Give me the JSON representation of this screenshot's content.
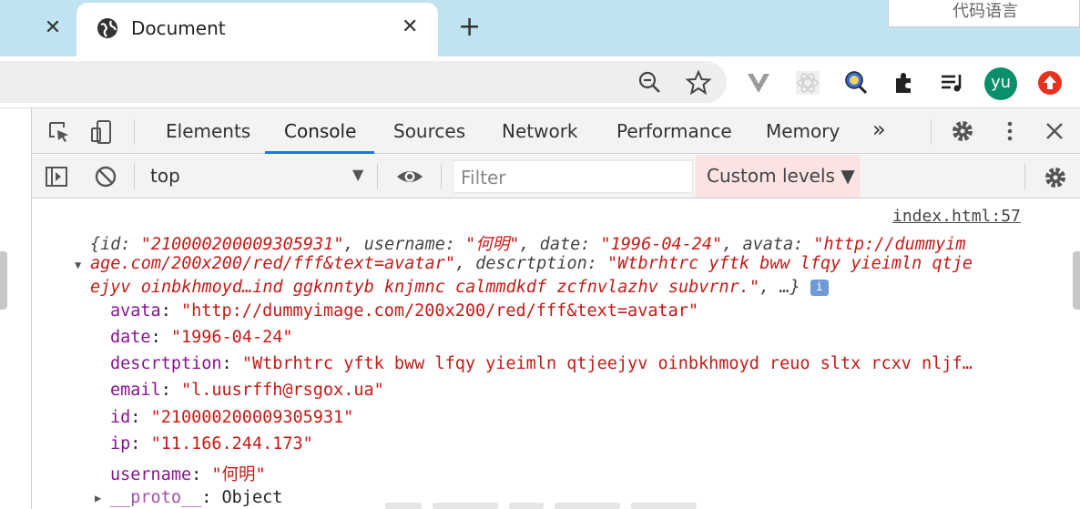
{
  "browser": {
    "tab_title": "Document",
    "new_tab": "+",
    "close": "✕",
    "ime_label": "代码语言",
    "avatar_initials": "yu",
    "accent": "#1a73e8"
  },
  "devtools": {
    "tabs": [
      "Elements",
      "Console",
      "Sources",
      "Network",
      "Performance",
      "Memory"
    ],
    "more": "»",
    "context": "top",
    "filter_placeholder": "Filter",
    "levels": "Custom levels ▼"
  },
  "console": {
    "source": "index.html:57",
    "summary": [
      "{id: ",
      "\"210000200009305931\"",
      ", username: ",
      "\"何明\"",
      ", date: ",
      "\"1996-04-24\"",
      ", avata: ",
      "\"http://dummyim",
      "age.com/200x200/red/fff&text=avatar\"",
      ", descrtption: ",
      "\"Wtbrhtrc yftk bww lfqy yieimln qtje",
      "ejyv oinbkhmoyd…ind ggknntyb knjmnc calmmdkdf zcfnvlazhv subvrnr.\"",
      ", …}"
    ],
    "info": "i",
    "props": [
      {
        "key": "avata",
        "value": "\"http://dummyimage.com/200x200/red/fff&text=avatar\""
      },
      {
        "key": "date",
        "value": "\"1996-04-24\""
      },
      {
        "key": "descrtption",
        "value": "\"Wtbrhtrc yftk bww lfqy yieimln qtjeejyv oinbkhmoyd reuo sltx rcxv nljf…"
      },
      {
        "key": "email",
        "value": "\"l.uusrffh@rsgox.ua\""
      },
      {
        "key": "id",
        "value": "\"210000200009305931\""
      },
      {
        "key": "ip",
        "value": "\"11.166.244.173\""
      },
      {
        "key": "username",
        "value": "\"何明\""
      }
    ],
    "proto_key": "__proto__",
    "proto_value": "Object"
  }
}
